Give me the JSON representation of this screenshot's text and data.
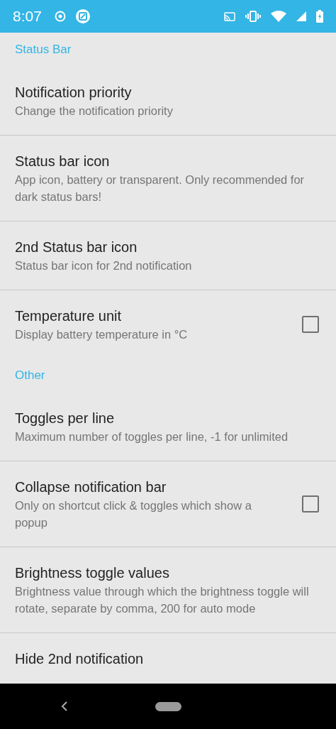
{
  "status_bar": {
    "time": "8:07"
  },
  "sections": [
    {
      "title": "Status Bar",
      "items": [
        {
          "kind": "plain",
          "title": "Notification priority",
          "summary": "Change the notification priority"
        },
        {
          "kind": "plain",
          "title": "Status bar icon",
          "summary": "App icon, battery or transparent. Only recommended for dark status bars!"
        },
        {
          "kind": "plain",
          "title": "2nd Status bar icon",
          "summary": "Status bar icon for 2nd notification"
        },
        {
          "kind": "checkbox",
          "title": "Temperature unit",
          "summary": "Display battery temperature in °C",
          "checked": false
        }
      ]
    },
    {
      "title": "Other",
      "items": [
        {
          "kind": "plain",
          "title": "Toggles per line",
          "summary": "Maximum number of toggles per line, -1 for unlimited"
        },
        {
          "kind": "checkbox",
          "title": "Collapse notification bar",
          "summary": "Only on shortcut click & toggles which show a popup",
          "checked": false
        },
        {
          "kind": "plain",
          "title": "Brightness toggle values",
          "summary": "Brightness value through which the brightness toggle will rotate, separate by comma, 200 for auto mode"
        },
        {
          "kind": "plain",
          "title": "Hide 2nd notification"
        }
      ]
    }
  ]
}
